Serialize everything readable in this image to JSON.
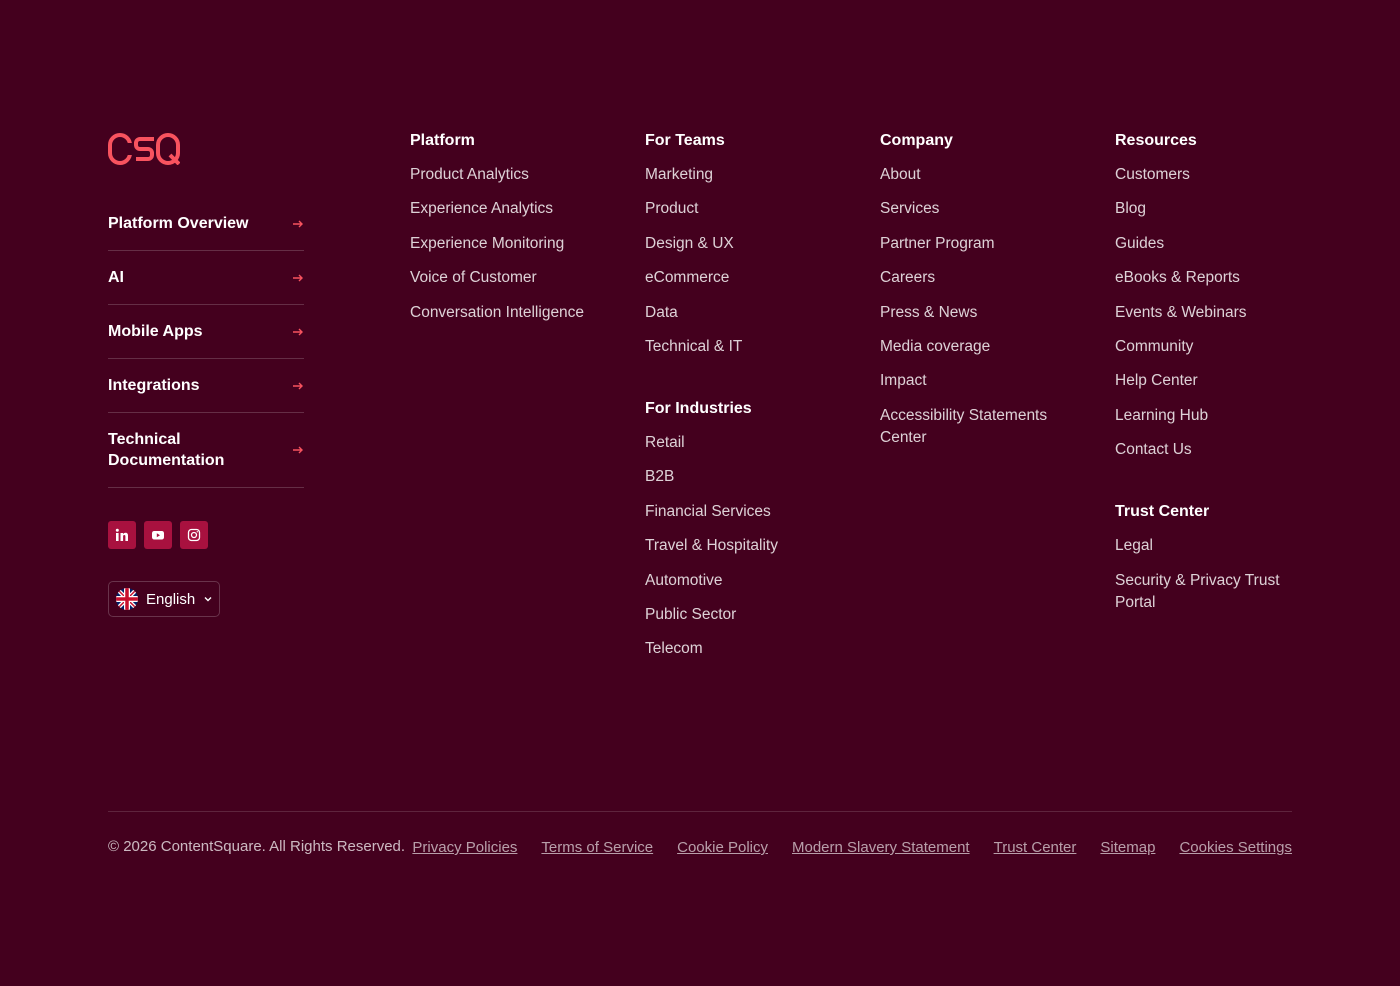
{
  "brand": {
    "logo_text": "CSQ",
    "accent_color": "#f8535f",
    "background_color": "#44001e"
  },
  "left_nav": [
    {
      "label": "Platform Overview",
      "icon": "arrow-right-icon"
    },
    {
      "label": "AI",
      "icon": "arrow-right-icon"
    },
    {
      "label": "Mobile Apps",
      "icon": "arrow-right-icon"
    },
    {
      "label": "Integrations",
      "icon": "arrow-right-icon"
    },
    {
      "label": "Technical Documentation",
      "icon": "arrow-right-icon"
    }
  ],
  "social": [
    {
      "name": "linkedin-icon"
    },
    {
      "name": "youtube-icon"
    },
    {
      "name": "instagram-icon"
    }
  ],
  "language": {
    "selected": "English",
    "flag": "uk-flag-icon"
  },
  "columns": {
    "platform": {
      "title": "Platform",
      "links": [
        "Product Analytics",
        "Experience Analytics",
        "Experience Monitoring",
        "Voice of Customer",
        "Conversation Intelligence"
      ]
    },
    "for_teams": {
      "title": "For Teams",
      "links": [
        "Marketing",
        "Product",
        "Design & UX",
        "eCommerce",
        "Data",
        "Technical & IT"
      ]
    },
    "for_industries": {
      "title": "For Industries",
      "links": [
        "Retail",
        "B2B",
        "Financial Services",
        "Travel & Hospitality",
        "Automotive",
        "Public Sector",
        "Telecom"
      ]
    },
    "company": {
      "title": "Company",
      "links": [
        "About",
        "Services",
        "Partner Program",
        "Careers",
        "Press & News",
        "Media coverage",
        "Impact",
        "Accessibility Statements Center"
      ]
    },
    "resources": {
      "title": "Resources",
      "links": [
        "Customers",
        "Blog",
        "Guides",
        "eBooks & Reports",
        "Events & Webinars",
        "Community",
        "Help Center",
        "Learning Hub",
        "Contact Us"
      ]
    },
    "trust_center": {
      "title": "Trust Center",
      "links": [
        "Legal",
        "Security & Privacy Trust Portal"
      ]
    }
  },
  "bottom": {
    "copyright": "© 2026 ContentSquare. All Rights Reserved.",
    "legal_links": [
      "Privacy Policies",
      "Terms of Service",
      "Cookie Policy",
      "Modern Slavery Statement",
      "Trust Center",
      "Sitemap",
      "Cookies Settings"
    ]
  }
}
